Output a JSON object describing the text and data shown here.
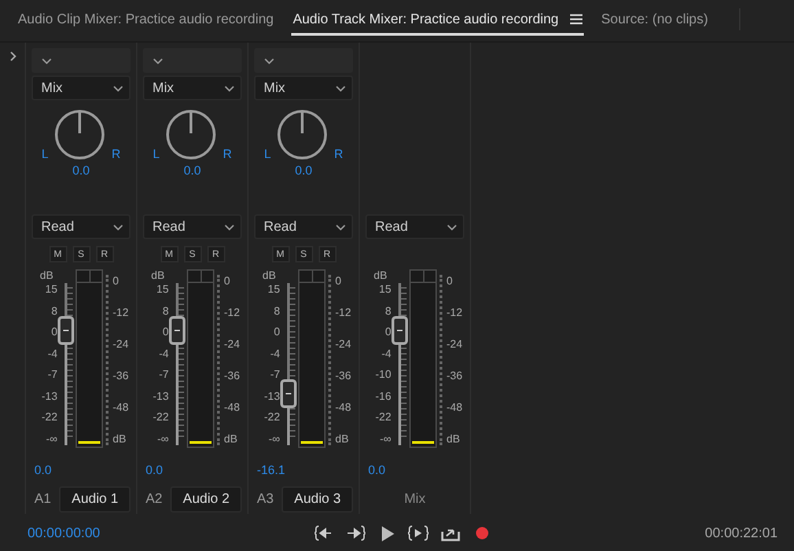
{
  "tabs": [
    {
      "label": "Audio Clip Mixer: Practice audio recording",
      "selected": false
    },
    {
      "label": "Audio Track Mixer: Practice audio recording",
      "selected": true
    },
    {
      "label": "Source: (no clips)",
      "selected": false
    }
  ],
  "channels": [
    {
      "kind": "track",
      "send": "Mix",
      "pan": {
        "left": "L",
        "right": "R",
        "value": "0.0"
      },
      "automation": "Read",
      "buttons": [
        "M",
        "S",
        "R"
      ],
      "fader": {
        "unit": "dB",
        "scale": [
          "15",
          "8",
          "0",
          "-4",
          "-7",
          "-13",
          "-22",
          "-∞"
        ],
        "level": 0.75
      },
      "meter_scale": [
        "0",
        "-12",
        "-24",
        "-36",
        "-48",
        "dB"
      ],
      "volume": "0.0",
      "track_id": "A1",
      "name": "Audio 1"
    },
    {
      "kind": "track",
      "send": "Mix",
      "pan": {
        "left": "L",
        "right": "R",
        "value": "0.0"
      },
      "automation": "Read",
      "buttons": [
        "M",
        "S",
        "R"
      ],
      "fader": {
        "unit": "dB",
        "scale": [
          "15",
          "8",
          "0",
          "-4",
          "-7",
          "-13",
          "-22",
          "-∞"
        ],
        "level": 0.75
      },
      "meter_scale": [
        "0",
        "-12",
        "-24",
        "-36",
        "-48",
        "dB"
      ],
      "volume": "0.0",
      "track_id": "A2",
      "name": "Audio 2"
    },
    {
      "kind": "track",
      "send": "Mix",
      "pan": {
        "left": "L",
        "right": "R",
        "value": "0.0"
      },
      "automation": "Read",
      "buttons": [
        "M",
        "S",
        "R"
      ],
      "fader": {
        "unit": "dB",
        "scale": [
          "15",
          "8",
          "0",
          "-4",
          "-7",
          "-13",
          "-22",
          "-∞"
        ],
        "level": 0.28
      },
      "meter_scale": [
        "0",
        "-12",
        "-24",
        "-36",
        "-48",
        "dB"
      ],
      "volume": "-16.1",
      "track_id": "A3",
      "name": "Audio 3"
    },
    {
      "kind": "master",
      "automation": "Read",
      "fader": {
        "unit": "dB",
        "scale": [
          "15",
          "8",
          "0",
          "-4",
          "-10",
          "-16",
          "-22",
          "-∞"
        ],
        "level": 0.75
      },
      "meter_scale": [
        "0",
        "-12",
        "-24",
        "-36",
        "-48",
        "dB"
      ],
      "volume": "0.0",
      "name": "Mix"
    }
  ],
  "footer": {
    "current_time": "00:00:00:00",
    "duration": "00:00:22:01"
  }
}
